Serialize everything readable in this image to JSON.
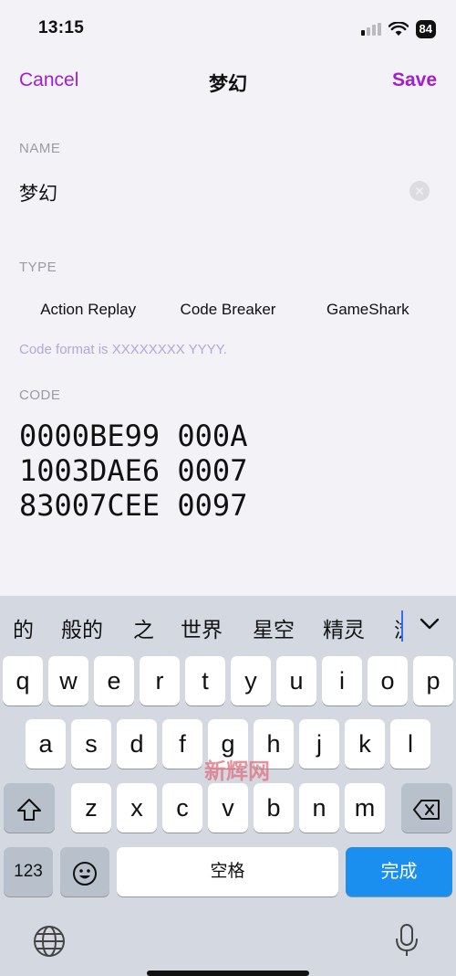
{
  "status_bar": {
    "time": "13:15",
    "battery": "84"
  },
  "nav": {
    "cancel": "Cancel",
    "title": "梦幻",
    "save": "Save"
  },
  "name_section": {
    "label": "NAME",
    "value": "梦幻"
  },
  "type_section": {
    "label": "TYPE",
    "options": [
      "Action Replay",
      "Code Breaker",
      "GameShark"
    ],
    "hint": "Code format is XXXXXXXX YYYY."
  },
  "code_section": {
    "label": "CODE",
    "lines": [
      "0000BE99 000A",
      "1003DAE6 0007",
      "83007CEE 0097"
    ]
  },
  "keyboard": {
    "candidates": [
      "的",
      "般的",
      "之",
      "世界",
      "星空",
      "精灵",
      "浏"
    ],
    "row1": [
      "q",
      "w",
      "e",
      "r",
      "t",
      "y",
      "u",
      "i",
      "o",
      "p"
    ],
    "row2": [
      "a",
      "s",
      "d",
      "f",
      "g",
      "h",
      "j",
      "k",
      "l"
    ],
    "row3": [
      "z",
      "x",
      "c",
      "v",
      "b",
      "n",
      "m"
    ],
    "num_key": "123",
    "space_key": "空格",
    "done_key": "完成"
  },
  "watermark": "新辉网",
  "colors": {
    "accent": "#a020d0",
    "done": "#1a8ff0",
    "keyboard_bg": "#d4d9e1"
  }
}
